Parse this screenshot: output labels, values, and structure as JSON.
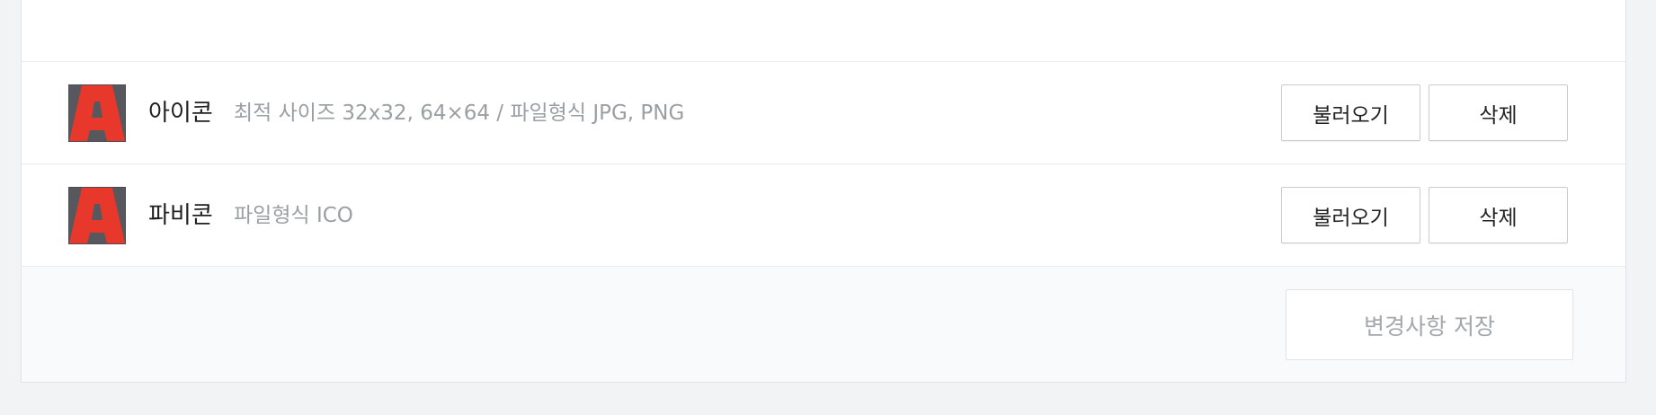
{
  "rows": [
    {
      "title": "아이콘",
      "description": "최적 사이즈 32x32, 64×64 / 파일형식 JPG, PNG",
      "thumb_icon": "letter-a-logo-icon",
      "load_label": "불러오기",
      "delete_label": "삭제"
    },
    {
      "title": "파비콘",
      "description": "파일형식 ICO",
      "thumb_icon": "letter-a-logo-icon",
      "load_label": "불러오기",
      "delete_label": "삭제"
    }
  ],
  "footer": {
    "save_label": "변경사항 저장"
  },
  "colors": {
    "logo_red": "#e8382b",
    "logo_bg": "#56585e",
    "page_bg": "#f2f3f5",
    "footer_bg": "#f9fafb",
    "muted_text": "#9b9ea3"
  }
}
